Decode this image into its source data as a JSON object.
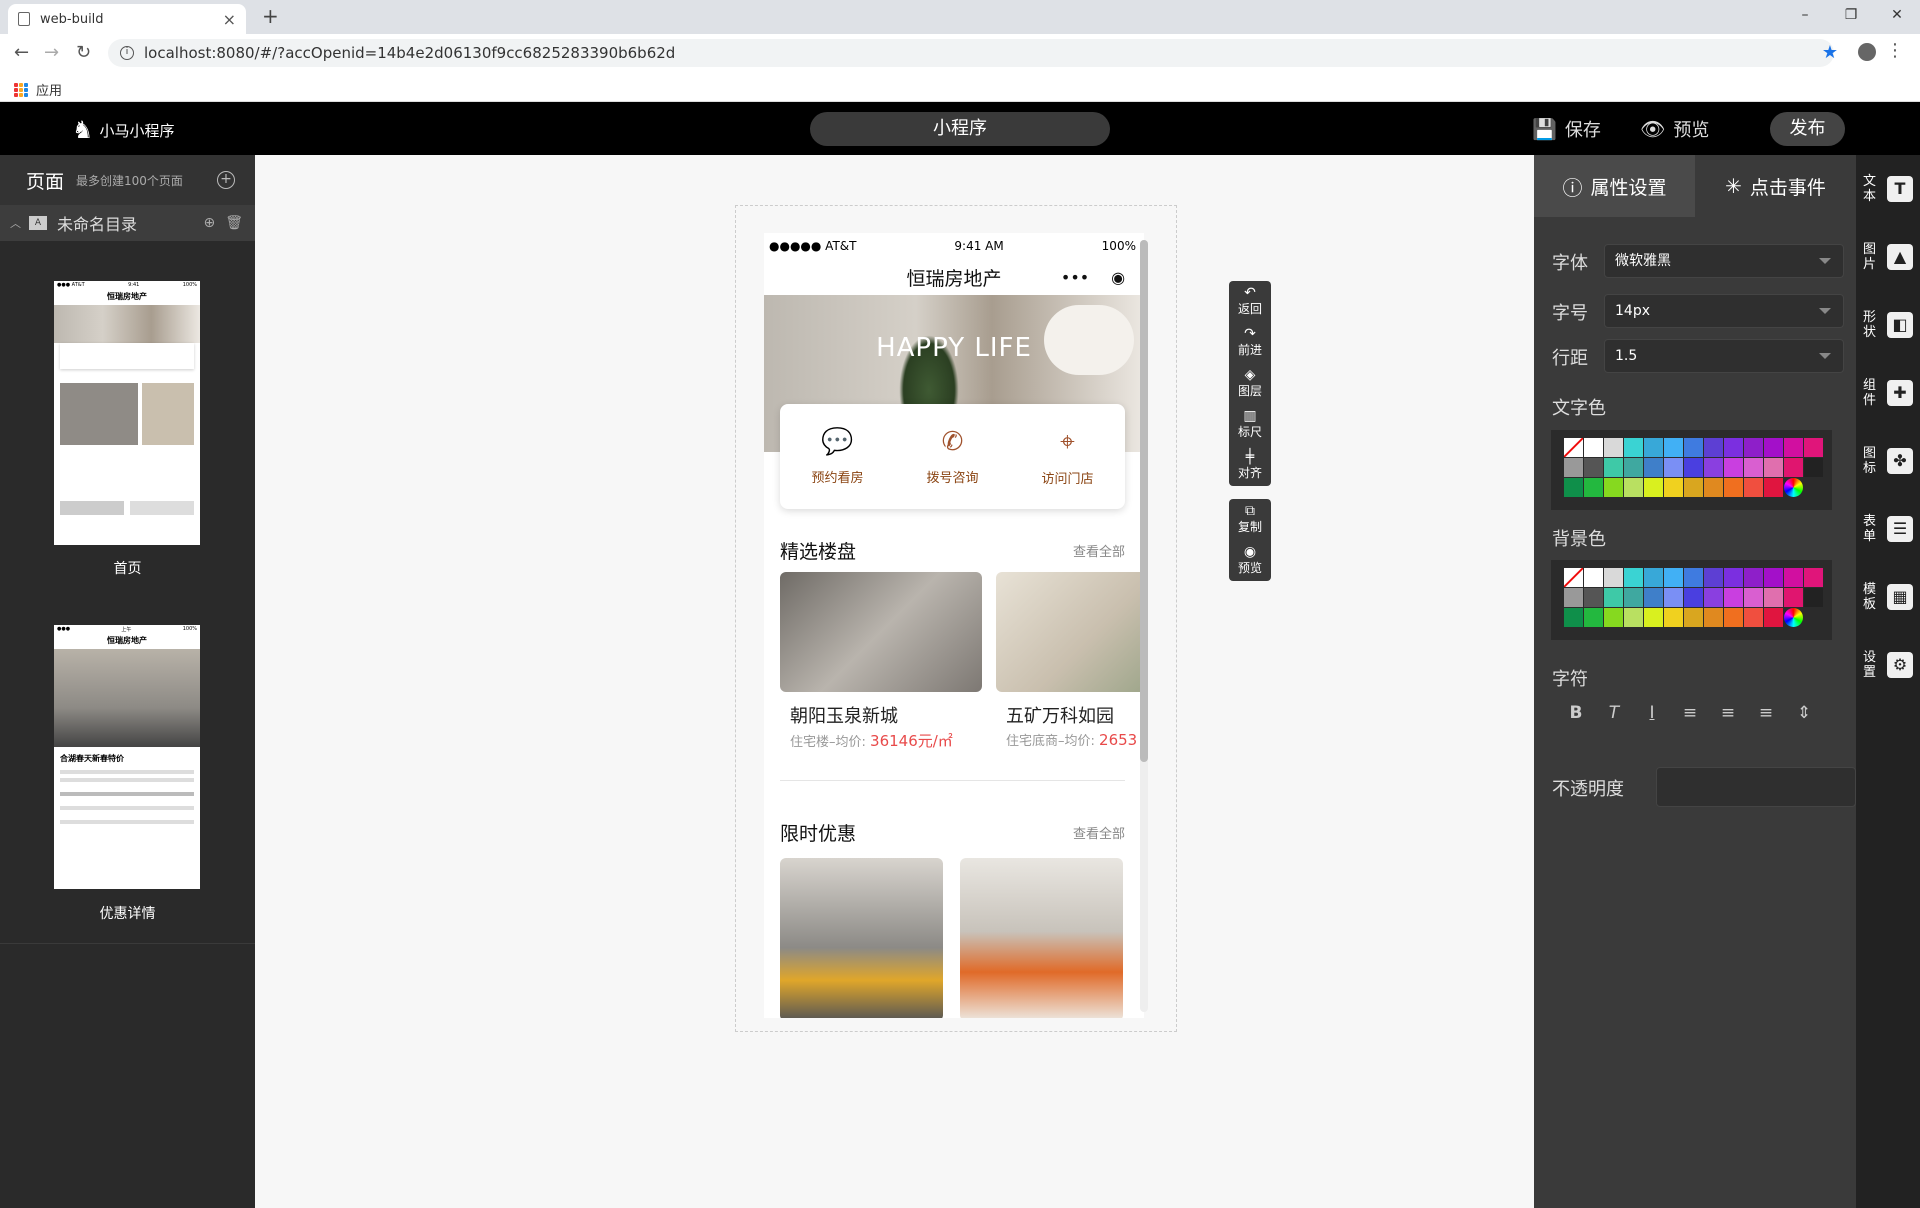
{
  "browser": {
    "tab_title": "web-build",
    "url": "localhost:8080/#/?accOpenid=14b4e2d06130f9cc6825283390b6b62d",
    "bookmark": "应用"
  },
  "header": {
    "logo_text": "小马小程序",
    "project_title": "小程序",
    "save": "保存",
    "preview": "预览",
    "publish": "发布"
  },
  "left": {
    "title": "页面",
    "subtitle": "最多创建100个页面",
    "directory": "未命名目录",
    "pages": [
      {
        "label": "首页",
        "thumb_title": "恒瑞房地产"
      },
      {
        "label": "优惠详情",
        "thumb_title": "恒瑞房地产",
        "thumb_heading": "合湖春天新春特价"
      }
    ]
  },
  "phone": {
    "carrier": "●●●●● AT&T",
    "time": "9:41 AM",
    "battery": "100%",
    "title": "恒瑞房地产",
    "banner_text": "HAPPY LIFE",
    "quick": [
      {
        "label": "预约看房",
        "icon": "chat-icon"
      },
      {
        "label": "拨号咨询",
        "icon": "phone-icon"
      },
      {
        "label": "访问门店",
        "icon": "location-icon"
      }
    ],
    "section1": {
      "title": "精选楼盘",
      "all": "查看全部"
    },
    "properties": [
      {
        "name": "朝阳玉泉新城",
        "type": "住宅楼–均价:",
        "price": "36146元/㎡",
        "bg": "#8f8b86"
      },
      {
        "name": "五矿万科如园",
        "type": "住宅底商–均价:",
        "price": "2653",
        "bg": "#c9bfae"
      }
    ],
    "section2": {
      "title": "限时优惠",
      "all": "查看全部"
    }
  },
  "tools": [
    {
      "label": "返回",
      "icon": "undo-icon"
    },
    {
      "label": "前进",
      "icon": "redo-icon"
    },
    {
      "label": "图层",
      "icon": "layers-icon"
    },
    {
      "label": "标尺",
      "icon": "ruler-icon"
    },
    {
      "label": "对齐",
      "icon": "align-icon"
    }
  ],
  "tools2": [
    {
      "label": "复制",
      "icon": "copy-icon"
    },
    {
      "label": "预览",
      "icon": "eye-icon"
    }
  ],
  "props": {
    "tab_attr": "属性设置",
    "tab_event": "点击事件",
    "font_label": "字体",
    "font_value": "微软雅黑",
    "size_label": "字号",
    "size_value": "14px",
    "line_label": "行距",
    "line_value": "1.5",
    "text_color": "文字色",
    "bg_color": "背景色",
    "char_label": "字符",
    "opacity_label": "不透明度"
  },
  "palette": [
    "none",
    "#ffffff",
    "#d9d9d9",
    "#3ad3d3",
    "#38a8d8",
    "#41b0f5",
    "#3f7be0",
    "#5d3fd3",
    "#7b2fe0",
    "#8e1fc9",
    "#a310c9",
    "#d10fa0",
    "#e0157a",
    "#999999",
    "#555555",
    "#3ec9a7",
    "#3fa8a0",
    "#3f7fc9",
    "#7a8ff5",
    "#4a3fe0",
    "#8a3fe0",
    "#c93fe0",
    "#d95fd0",
    "#e06fae",
    "#e0156f",
    "#222222",
    "#0f8f4a",
    "#23b83f",
    "#86d91f",
    "#b9e061",
    "#d9f01f",
    "#f0d11f",
    "#d9a61f",
    "#e0891f",
    "#f06f1f",
    "#f04f3f",
    "#e0153f",
    "rainbow"
  ],
  "sidebar": [
    {
      "label": "文本",
      "icon": "text-icon",
      "glyph": "T"
    },
    {
      "label": "图片",
      "icon": "image-icon",
      "glyph": "▲"
    },
    {
      "label": "形状",
      "icon": "shape-icon",
      "glyph": "◧"
    },
    {
      "label": "组件",
      "icon": "puzzle-icon",
      "glyph": "✚"
    },
    {
      "label": "图标",
      "icon": "clover-icon",
      "glyph": "✤"
    },
    {
      "label": "表单",
      "icon": "form-icon",
      "glyph": "☰"
    },
    {
      "label": "模板",
      "icon": "template-icon",
      "glyph": "▦"
    },
    {
      "label": "设置",
      "icon": "gear-icon",
      "glyph": "⚙"
    }
  ]
}
